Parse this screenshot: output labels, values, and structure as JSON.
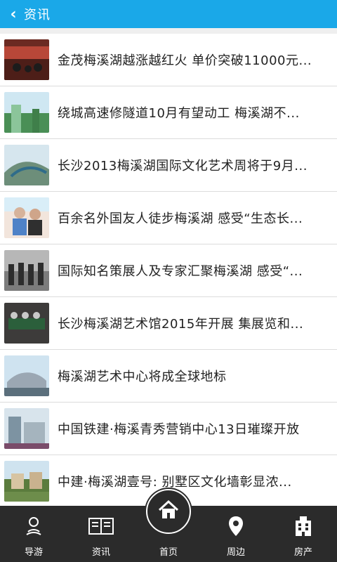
{
  "header": {
    "back_icon": "chevron-left",
    "title": "资讯"
  },
  "news": [
    {
      "title": "金茂梅溪湖越涨越红火 单价突破11000元...",
      "thumb_color": "#6b2a22"
    },
    {
      "title": "绕城高速修隧道10月有望动工 梅溪湖不...",
      "thumb_color": "#4a8f56"
    },
    {
      "title": "长沙2013梅溪湖国际文化艺术周将于9月...",
      "thumb_color": "#6d8e7a"
    },
    {
      "title": "百余名外国友人徒步梅溪湖 感受“生态长...",
      "thumb_color": "#d6b39b"
    },
    {
      "title": "国际知名策展人及专家汇聚梅溪湖 感受“...",
      "thumb_color": "#7c7c7c"
    },
    {
      "title": "长沙梅溪湖艺术馆2015年开展 集展览和...",
      "thumb_color": "#3d3b3a"
    },
    {
      "title": "梅溪湖艺术中心将成全球地标",
      "thumb_color": "#9ba7b3"
    },
    {
      "title": "中国铁建·梅溪青秀营销中心13日璀璨开放",
      "thumb_color": "#7d93a2"
    },
    {
      "title": "中建·梅溪湖壹号: 别墅区文化墙彰显浓...",
      "thumb_color": "#5b7c3d"
    }
  ],
  "tabs": [
    {
      "label": "导游",
      "icon": "guide-icon"
    },
    {
      "label": "资讯",
      "icon": "news-icon"
    },
    {
      "label": "首页",
      "icon": "home-icon"
    },
    {
      "label": "周边",
      "icon": "location-pin-icon"
    },
    {
      "label": "房产",
      "icon": "building-icon"
    }
  ],
  "colors": {
    "accent": "#1aa8e8",
    "tabbar": "#2b2b2b"
  }
}
